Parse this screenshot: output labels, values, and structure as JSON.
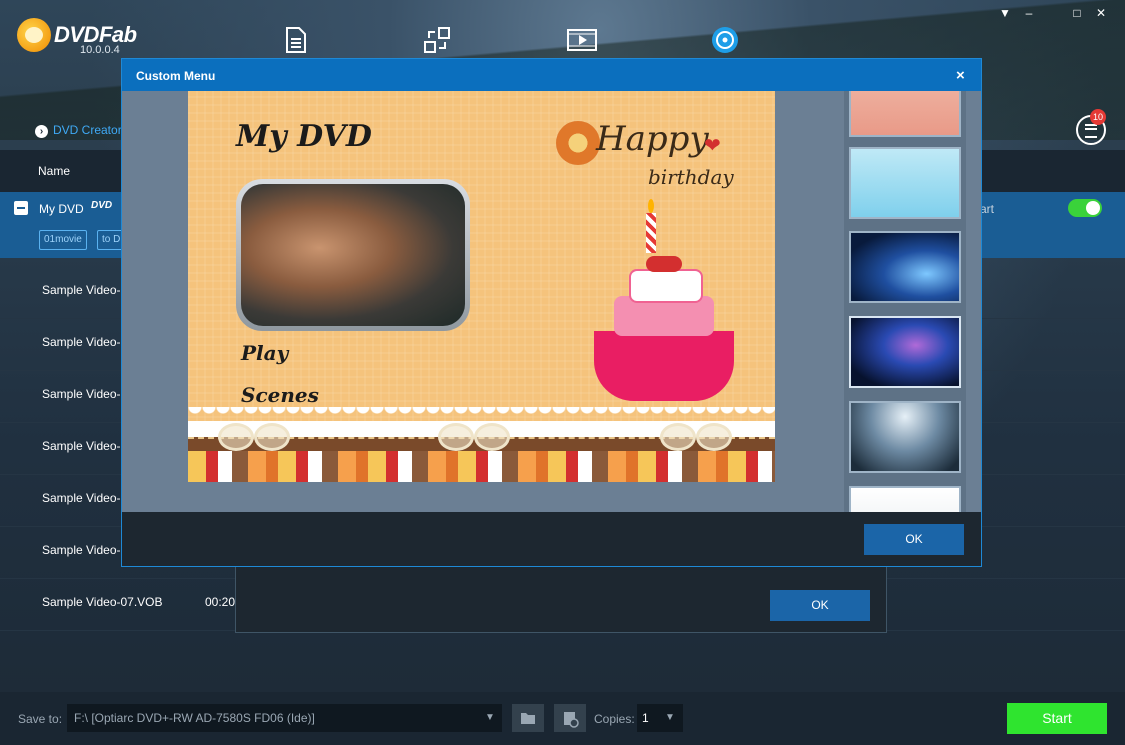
{
  "app": {
    "name": "DVDFab",
    "version": "10.0.0.4"
  },
  "window_controls": {
    "pin": "▼",
    "minimize": "‒",
    "maximize": "□",
    "close": "✕"
  },
  "nav_icons": [
    "document-icon",
    "convert-icon",
    "video-icon",
    "disc-icon"
  ],
  "left": {
    "breadcrumb": "DVD Creator",
    "queue_badge": "10",
    "header_name": "Name",
    "selected_item": {
      "label": "My DVD",
      "logo": "DVD",
      "tags": [
        "01movie",
        "to D"
      ],
      "art_text": "art"
    },
    "rows": [
      "Sample Video-",
      "Sample Video-",
      "Sample Video-",
      "Sample Video-",
      "Sample Video-",
      "Sample Video-",
      "Sample Video-07.VOB"
    ],
    "last_row_duration": "00:20"
  },
  "back_dialog": {
    "ok_label": "OK"
  },
  "modal": {
    "title": "Custom Menu",
    "close": "×",
    "ok_label": "OK",
    "preview": {
      "title": "My DVD",
      "play": "Play",
      "scenes": "Scenes",
      "happy": "Happy",
      "birthday": "birthday"
    }
  },
  "bottom": {
    "save_to_label": "Save to:",
    "save_to_value": "F:\\ [Optiarc DVD+-RW AD-7580S FD06 (Ide)]",
    "copies_label": "Copies:",
    "copies_value": "1",
    "start_label": "Start"
  },
  "colors": {
    "accent": "#0b6fbe",
    "start": "#2fe42f",
    "toggle": "#3ad23a",
    "badge": "#e53935"
  }
}
